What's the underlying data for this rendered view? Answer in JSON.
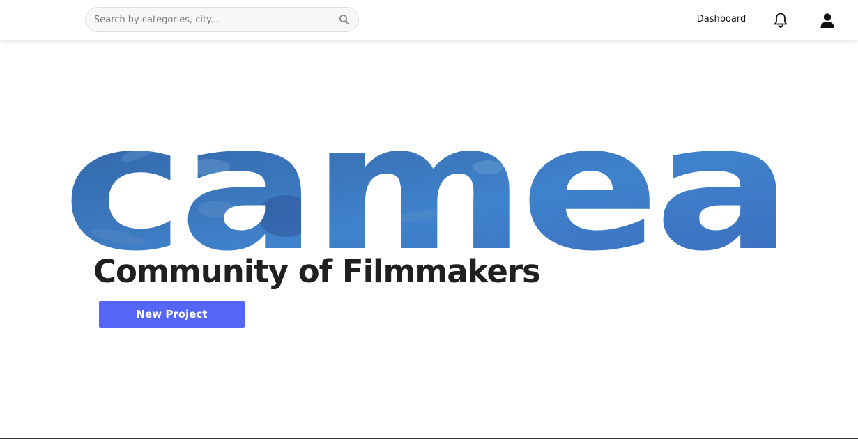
{
  "header": {
    "search": {
      "placeholder": "Search by categories, city..."
    },
    "dashboard_label": "Dashboard"
  },
  "icons": {
    "search": "search-icon",
    "notifications": "bell-icon",
    "account": "user-icon"
  },
  "hero": {
    "logo_text": "camea",
    "tagline": "Community of Filmmakers",
    "cta_label": "New Project"
  },
  "colors": {
    "accent": "#5565f5",
    "logo_blue_light": "#4a86c8",
    "logo_blue_dark": "#2f5ea8",
    "text_dark": "#202020"
  }
}
